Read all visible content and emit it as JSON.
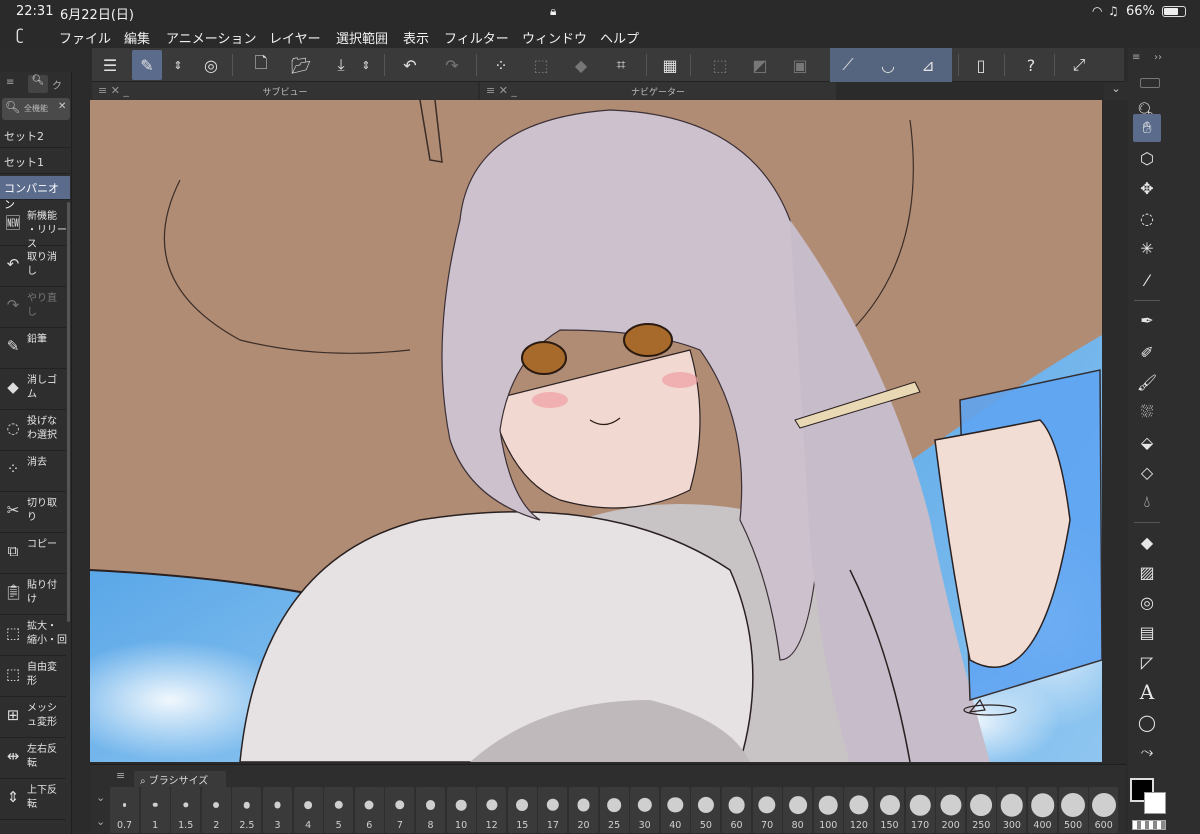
{
  "status": {
    "time": "22:31",
    "date": "6月22日(日)",
    "battery": "66%"
  },
  "menu": [
    "ファイル",
    "編集",
    "アニメーション",
    "レイヤー",
    "選択範囲",
    "表示",
    "フィルター",
    "ウィンドウ",
    "ヘルプ"
  ],
  "palettes": {
    "subview_title": "サブビュー",
    "navigator_title": "ナビゲーター",
    "brushsize_title": "ブラシサイズ"
  },
  "leftpanel": {
    "search_placeholder": "全機能",
    "sets": [
      "セット2",
      "セット1",
      "コンパニオン"
    ],
    "commands": [
      {
        "label": "新機能\n・リリース",
        "icon": "new-badge-icon",
        "enabled": true
      },
      {
        "label": "取り消\nし",
        "icon": "undo-icon",
        "enabled": true
      },
      {
        "label": "やり直\nし",
        "icon": "redo-icon",
        "enabled": false
      },
      {
        "label": "鉛筆",
        "icon": "pencil-icon",
        "enabled": true
      },
      {
        "label": "消しゴ\nム",
        "icon": "eraser-icon",
        "enabled": true
      },
      {
        "label": "投げな\nわ選択",
        "icon": "lasso-icon",
        "enabled": true
      },
      {
        "label": "消去",
        "icon": "clear-icon",
        "enabled": true
      },
      {
        "label": "切り取\nり",
        "icon": "scissors-icon",
        "enabled": true
      },
      {
        "label": "コピー",
        "icon": "copy-icon",
        "enabled": true
      },
      {
        "label": "貼り付\nけ",
        "icon": "paste-icon",
        "enabled": true
      },
      {
        "label": "拡大・\n縮小・回",
        "icon": "scale-icon",
        "enabled": true
      },
      {
        "label": "自由変\n形",
        "icon": "free-transform-icon",
        "enabled": true
      },
      {
        "label": "メッシ\nュ変形",
        "icon": "mesh-transform-icon",
        "enabled": true
      },
      {
        "label": "左右反\n転",
        "icon": "flip-horizontal-icon",
        "enabled": true
      },
      {
        "label": "上下反\n転",
        "icon": "flip-vertical-icon",
        "enabled": true
      }
    ]
  },
  "brush_sizes": [
    "0.7",
    "1",
    "1.5",
    "2",
    "2.5",
    "3",
    "4",
    "5",
    "6",
    "7",
    "8",
    "10",
    "12",
    "15",
    "17",
    "20",
    "25",
    "30",
    "40",
    "50",
    "60",
    "70",
    "80",
    "100",
    "120",
    "150",
    "170",
    "200",
    "250",
    "300",
    "400",
    "500",
    "600"
  ],
  "colors": {
    "accent": "#5a6b8c",
    "main_color": "#000000",
    "sub_color": "#ffffff"
  }
}
